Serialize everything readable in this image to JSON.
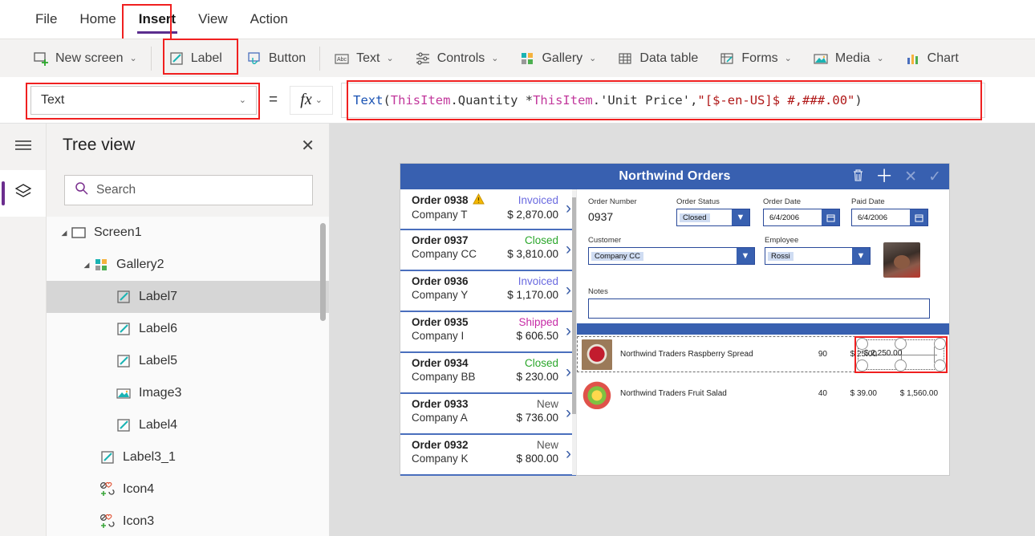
{
  "menu": {
    "items": [
      {
        "label": "File",
        "active": false
      },
      {
        "label": "Home",
        "active": false
      },
      {
        "label": "Insert",
        "active": true
      },
      {
        "label": "View",
        "active": false
      },
      {
        "label": "Action",
        "active": false
      }
    ]
  },
  "ribbon": {
    "items": [
      {
        "label": "New screen",
        "icon": "new-screen-icon",
        "caret": "⌄"
      },
      {
        "label": "Label",
        "icon": "label-icon",
        "caret": ""
      },
      {
        "label": "Button",
        "icon": "button-icon",
        "caret": ""
      },
      {
        "label": "Text",
        "icon": "text-icon",
        "caret": "⌄"
      },
      {
        "label": "Controls",
        "icon": "controls-icon",
        "caret": "⌄"
      },
      {
        "label": "Gallery",
        "icon": "gallery-icon",
        "caret": "⌄"
      },
      {
        "label": "Data table",
        "icon": "data-table-icon",
        "caret": ""
      },
      {
        "label": "Forms",
        "icon": "forms-icon",
        "caret": "⌄"
      },
      {
        "label": "Media",
        "icon": "media-icon",
        "caret": "⌄"
      },
      {
        "label": "Chart",
        "icon": "chart-icon",
        "caret": ""
      }
    ]
  },
  "formula_bar": {
    "property_selected": "Text",
    "equals": "=",
    "fx_label": "fx",
    "fx_caret": "⌄",
    "formula_text": "Text( ThisItem.Quantity * ThisItem.'Unit Price', \"[$-en-US]$ #,###.00\" )",
    "tokens": [
      {
        "t": "Text",
        "k": "fn"
      },
      {
        "t": "( ",
        "k": "punc"
      },
      {
        "t": "ThisItem",
        "k": "obj"
      },
      {
        "t": ".Quantity * ",
        "k": "prop"
      },
      {
        "t": "ThisItem",
        "k": "obj"
      },
      {
        "t": ".'Unit Price', ",
        "k": "prop"
      },
      {
        "t": "\"[$-en-US]$ #,###.00\"",
        "k": "str"
      },
      {
        "t": " )",
        "k": "punc"
      }
    ]
  },
  "rail": {
    "hamburger_icon": "hamburger-icon",
    "layers_icon": "layers-icon"
  },
  "tree_view": {
    "title": "Tree view",
    "close_label": "✕",
    "search_placeholder": "Search",
    "nodes": [
      {
        "label": "Screen1",
        "indent": 0,
        "icon": "screen-icon",
        "twisty": "◢",
        "selected": false
      },
      {
        "label": "Gallery2",
        "indent": 1,
        "icon": "gallery-icon",
        "twisty": "◢",
        "selected": false
      },
      {
        "label": "Label7",
        "indent": 2,
        "icon": "label-icon",
        "twisty": "",
        "selected": true
      },
      {
        "label": "Label6",
        "indent": 2,
        "icon": "label-icon",
        "twisty": "",
        "selected": false
      },
      {
        "label": "Label5",
        "indent": 2,
        "icon": "label-icon",
        "twisty": "",
        "selected": false
      },
      {
        "label": "Image3",
        "indent": 2,
        "icon": "image-icon",
        "twisty": "",
        "selected": false
      },
      {
        "label": "Label4",
        "indent": 2,
        "icon": "label-icon",
        "twisty": "",
        "selected": false
      },
      {
        "label": "Label3_1",
        "indent": 1,
        "icon": "label-icon",
        "twisty": "",
        "selected": false
      },
      {
        "label": "Icon4",
        "indent": 1,
        "icon": "icons-icon",
        "twisty": "",
        "selected": false
      },
      {
        "label": "Icon3",
        "indent": 1,
        "icon": "icons-icon",
        "twisty": "",
        "selected": false
      }
    ]
  },
  "app_preview": {
    "title": "Northwind Orders",
    "header_icons": [
      {
        "name": "trash-icon",
        "glyph": "🗑",
        "dimmed": false
      },
      {
        "name": "add-icon",
        "glyph": "＋",
        "dimmed": false
      },
      {
        "name": "cancel-icon",
        "glyph": "✕",
        "dimmed": true
      },
      {
        "name": "check-icon",
        "glyph": "✓",
        "dimmed": true
      }
    ],
    "orders": [
      {
        "order": "Order 0938",
        "company": "Company T",
        "status": "Invoiced",
        "status_class": "s-invoiced",
        "amount": "$ 2,870.00",
        "warning": true
      },
      {
        "order": "Order 0937",
        "company": "Company CC",
        "status": "Closed",
        "status_class": "s-closed",
        "amount": "$ 3,810.00",
        "warning": false
      },
      {
        "order": "Order 0936",
        "company": "Company Y",
        "status": "Invoiced",
        "status_class": "s-invoiced",
        "amount": "$ 1,170.00",
        "warning": false
      },
      {
        "order": "Order 0935",
        "company": "Company I",
        "status": "Shipped",
        "status_class": "s-shipped",
        "amount": "$ 606.50",
        "warning": false
      },
      {
        "order": "Order 0934",
        "company": "Company BB",
        "status": "Closed",
        "status_class": "s-closed",
        "amount": "$ 230.00",
        "warning": false
      },
      {
        "order": "Order 0933",
        "company": "Company A",
        "status": "New",
        "status_class": "s-new",
        "amount": "$ 736.00",
        "warning": false
      },
      {
        "order": "Order 0932",
        "company": "Company K",
        "status": "New",
        "status_class": "s-new",
        "amount": "$ 800.00",
        "warning": false
      }
    ],
    "form": {
      "order_number_label": "Order Number",
      "order_number_value": "0937",
      "order_status_label": "Order Status",
      "order_status_value": "Closed",
      "order_date_label": "Order Date",
      "order_date_value": "6/4/2006",
      "paid_date_label": "Paid Date",
      "paid_date_value": "6/4/2006",
      "customer_label": "Customer",
      "customer_value": "Company CC",
      "employee_label": "Employee",
      "employee_value": "Rossi",
      "notes_label": "Notes",
      "notes_value": ""
    },
    "line_items": [
      {
        "product": "Northwind Traders Raspberry Spread",
        "qty": "90",
        "price": "$ 25.00",
        "total": "$ 2,250.00",
        "selected": true
      },
      {
        "product": "Northwind Traders Fruit Salad",
        "qty": "40",
        "price": "$ 39.00",
        "total": "$ 1,560.00",
        "selected": false
      }
    ]
  },
  "colors": {
    "accent_purple": "#5b2d8e",
    "app_header_blue": "#3860b0",
    "highlight_red": "#f02020",
    "status_invoiced": "#6a6ae0",
    "status_closed": "#2aa62a",
    "status_shipped": "#c62ba6",
    "status_new": "#555555",
    "canvas_bg": "#dedede"
  }
}
